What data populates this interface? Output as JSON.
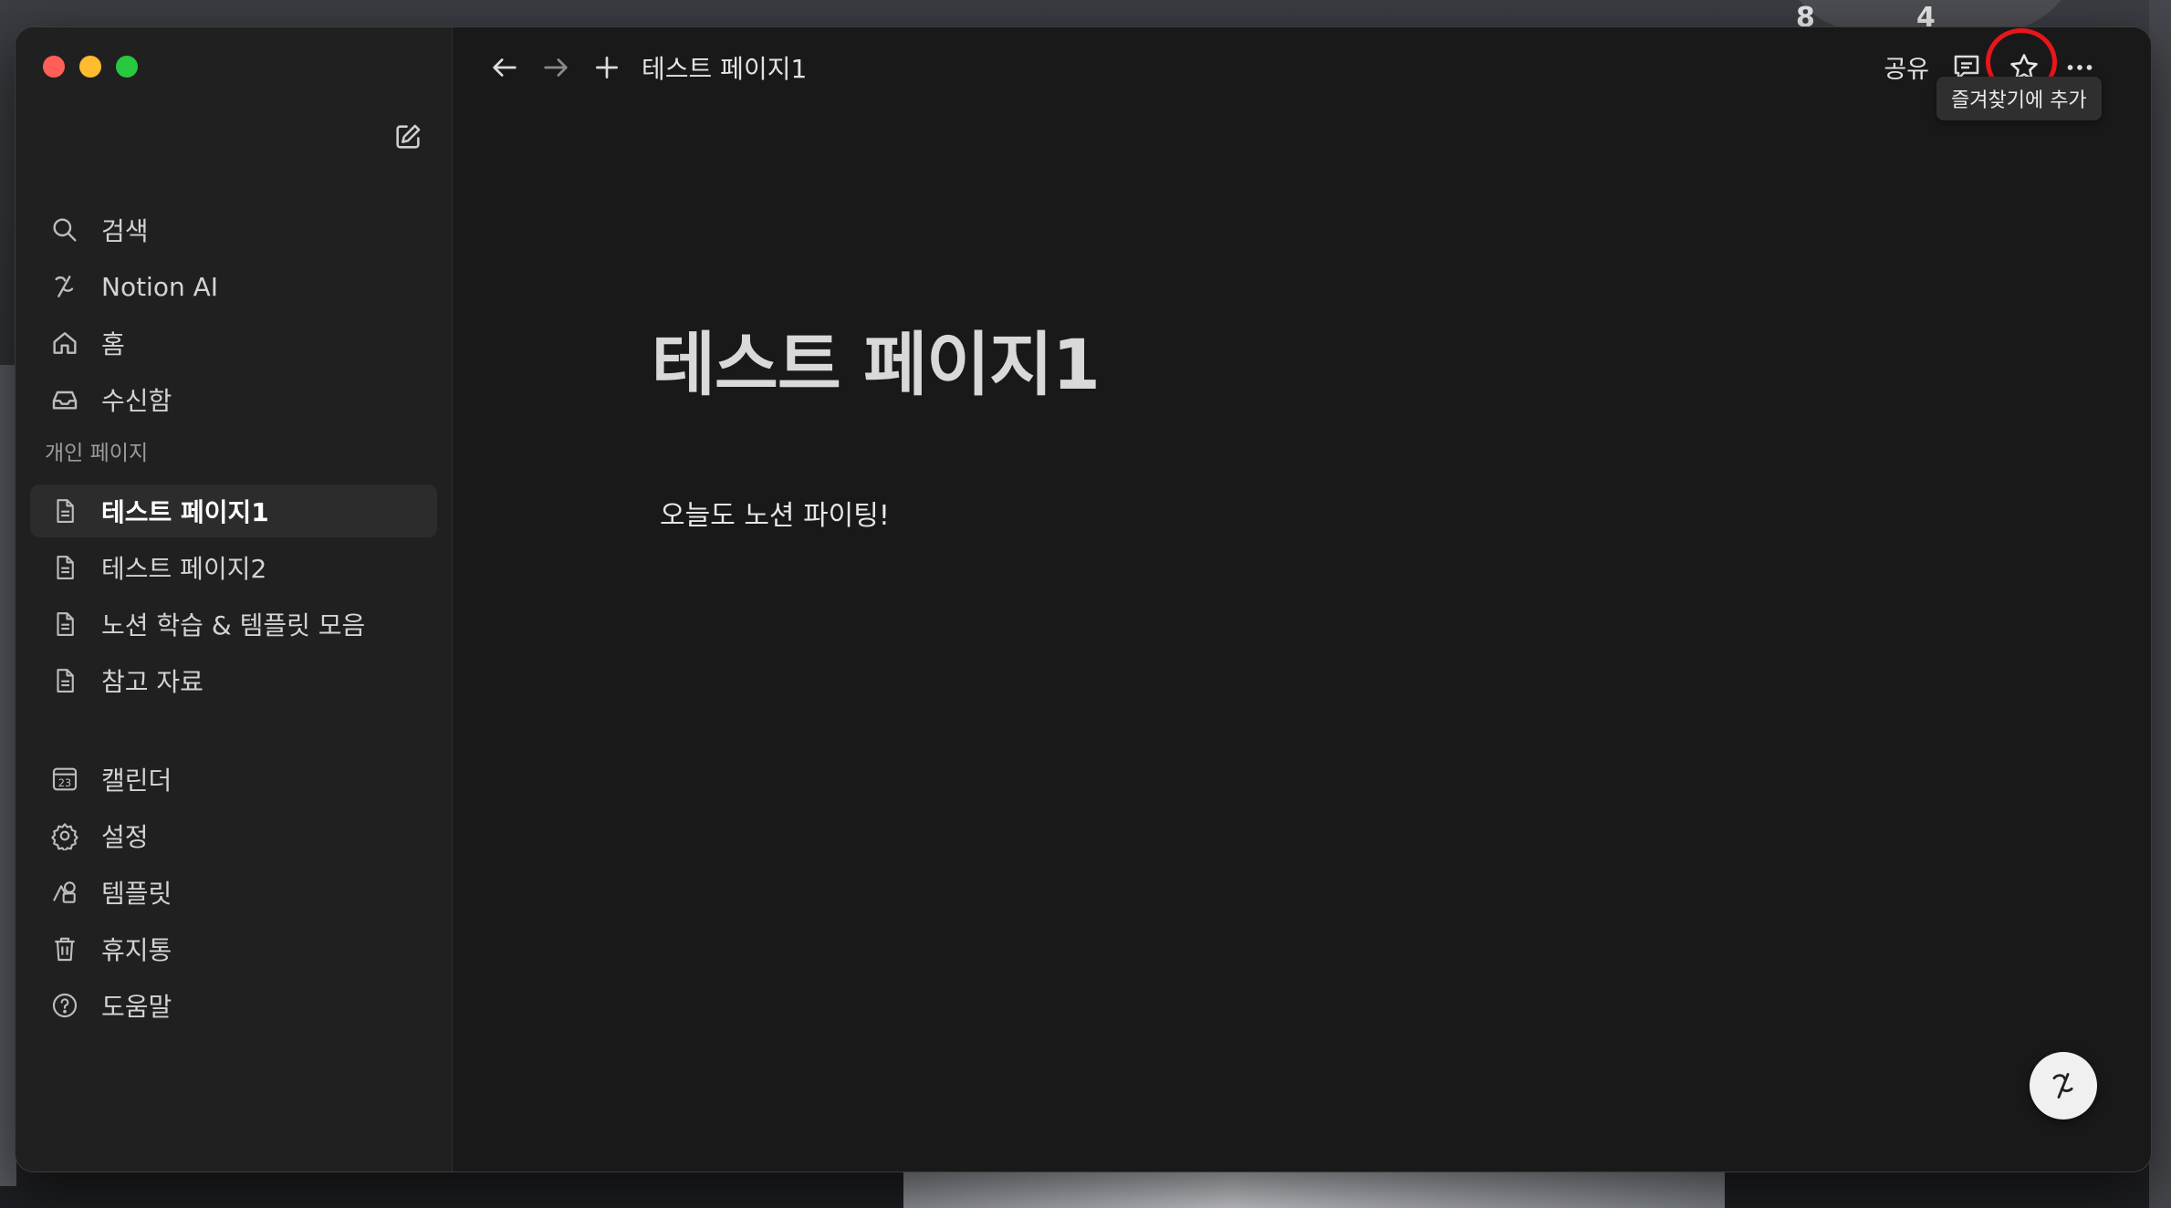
{
  "window": {
    "title": "테스트 페이지1"
  },
  "sidebar": {
    "top_items": [
      {
        "label": "검색",
        "icon": "search-icon"
      },
      {
        "label": "Notion AI",
        "icon": "notion-ai-icon"
      },
      {
        "label": "홈",
        "icon": "home-icon"
      },
      {
        "label": "수신함",
        "icon": "inbox-icon"
      }
    ],
    "section_label": "개인 페이지",
    "pages": [
      {
        "label": "테스트 페이지1",
        "icon": "page-icon",
        "active": true
      },
      {
        "label": "테스트 페이지2",
        "icon": "page-icon"
      },
      {
        "label": "노션 학습 & 템플릿 모음",
        "icon": "page-icon"
      },
      {
        "label": "참고 자료",
        "icon": "page-icon"
      }
    ],
    "bottom_items": [
      {
        "label": "캘린더",
        "icon": "calendar-icon",
        "icon_text": "23"
      },
      {
        "label": "설정",
        "icon": "gear-icon"
      },
      {
        "label": "템플릿",
        "icon": "templates-icon"
      },
      {
        "label": "휴지통",
        "icon": "trash-icon"
      },
      {
        "label": "도움말",
        "icon": "help-icon"
      }
    ]
  },
  "topbar": {
    "breadcrumb": "테스트 페이지1",
    "share_label": "공유",
    "tooltip": "즐겨찾기에 추가"
  },
  "page": {
    "title": "테스트 페이지1",
    "body": "오늘도 노션 파이팅!"
  },
  "colors": {
    "accent_highlight": "#e8161b",
    "window_bg": "#191919",
    "sidebar_bg": "#202020"
  }
}
